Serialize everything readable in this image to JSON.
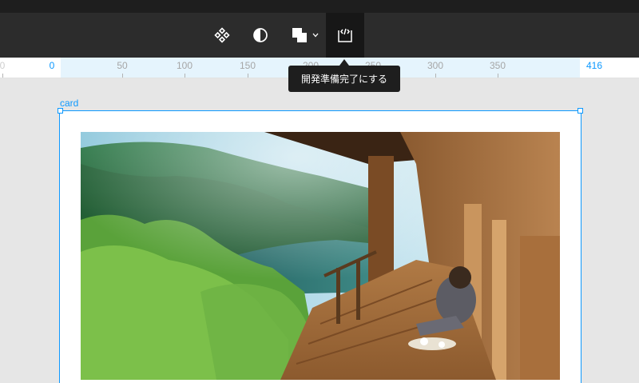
{
  "toolbar": {
    "tools": [
      {
        "icon": "component-icon",
        "label": ""
      },
      {
        "icon": "contrast-icon",
        "label": ""
      },
      {
        "icon": "boolean-groups-icon",
        "label": ""
      },
      {
        "icon": "dev-mode-icon",
        "label": "",
        "active": true
      }
    ]
  },
  "ruler": {
    "labels": [
      "0",
      "50",
      "100",
      "150",
      "200",
      "250",
      "300",
      "350",
      "416"
    ],
    "selection_start": "0",
    "selection_end": "416"
  },
  "tooltip": {
    "text": "開発準備完了にする"
  },
  "frame": {
    "name": "card"
  },
  "colors": {
    "selection": "#0d99ff",
    "toolbar_bg": "#2c2c2c",
    "canvas_bg": "#e6e6e6"
  }
}
